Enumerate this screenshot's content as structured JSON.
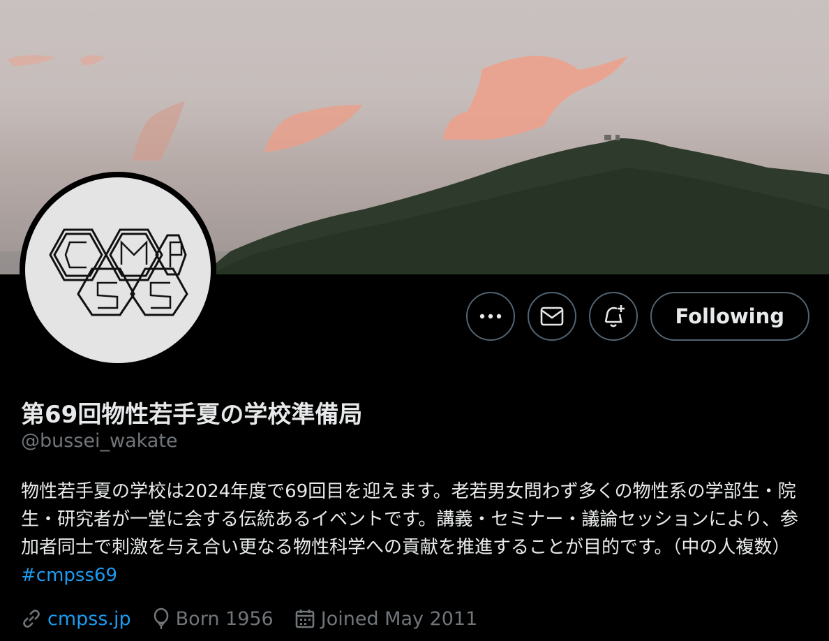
{
  "profile": {
    "display_name": "第69回物性若手夏の学校準備局",
    "handle": "@bussei_wakate",
    "bio_text": "物性若手夏の学校は2024年度で69回目を迎えます。老若男女問わず多くの物性系の学部生・院生・研究者が一堂に会する伝統あるイベントです。講義・セミナー・議論セッションにより、参加者同士で刺激を与え合い更なる物性科学への貢献を推進することが目的です。（中の人複数）",
    "bio_hashtag": "#cmpss69",
    "website": "cmpss.jp",
    "born": "Born 1956",
    "joined": "Joined May 2011"
  },
  "actions": {
    "following_label": "Following"
  },
  "icons": {
    "more": "more-icon",
    "message": "envelope-icon",
    "notify": "bell-plus-icon",
    "link": "link-icon",
    "born": "balloon-icon",
    "joined": "calendar-icon"
  },
  "colors": {
    "background": "#000000",
    "accent": "#1d9bf0",
    "muted": "#71767b",
    "border": "#536471"
  }
}
